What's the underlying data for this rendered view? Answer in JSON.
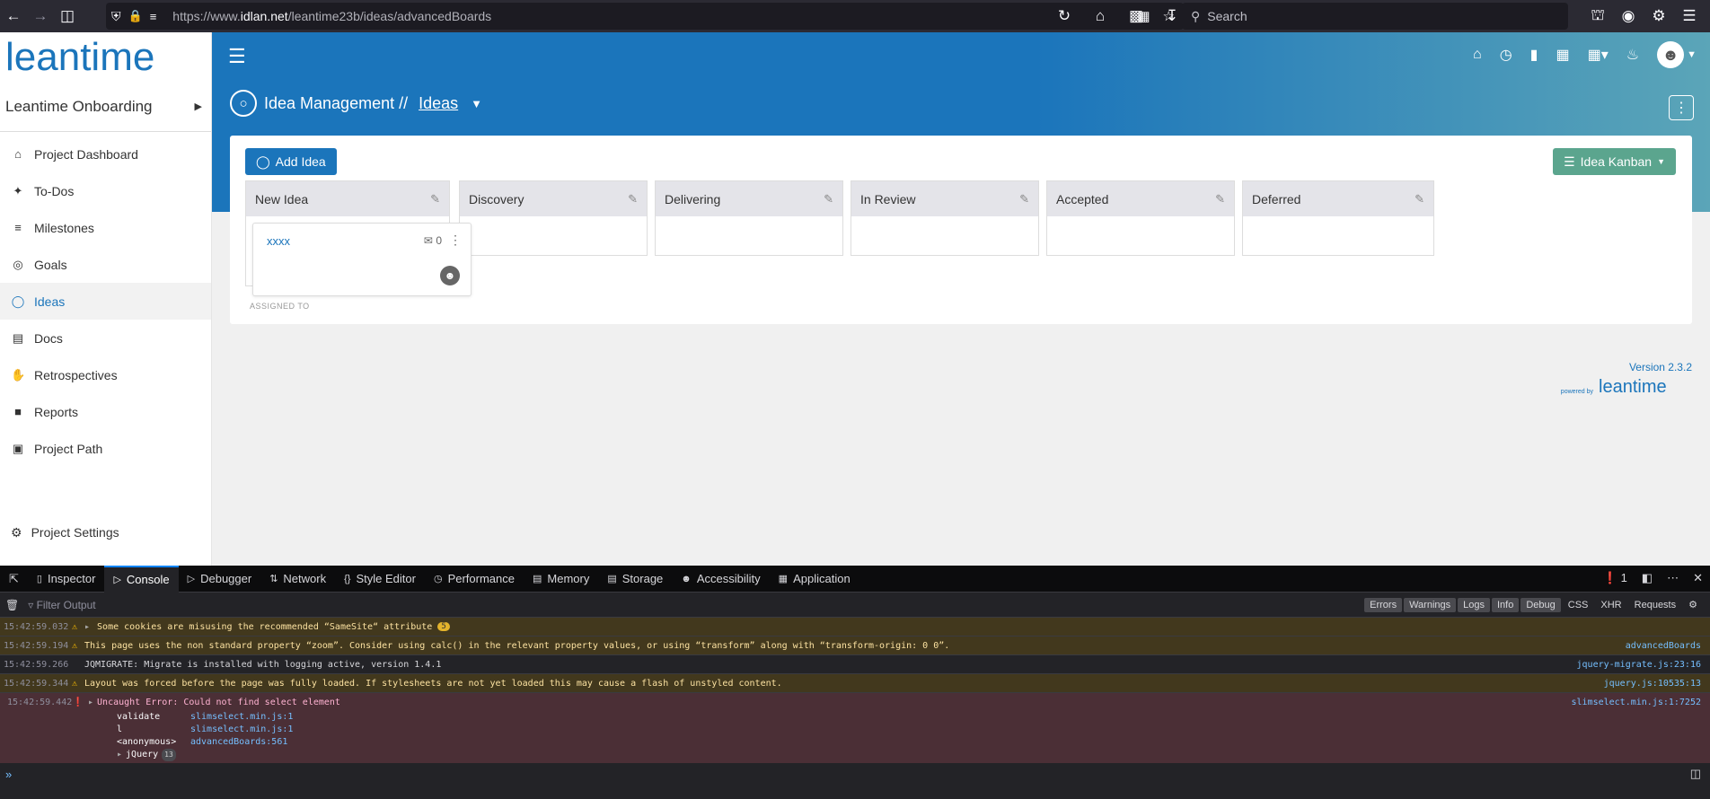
{
  "browser": {
    "url_prefix": "https://www.",
    "url_domain": "idlan.net",
    "url_path": "/leantime23b/ideas/advancedBoards",
    "search_placeholder": "Search"
  },
  "sidebar": {
    "logo_text": "leantime",
    "project_name": "Leantime Onboarding",
    "items": [
      {
        "label": "Project Dashboard",
        "icon": "home-icon"
      },
      {
        "label": "To-Dos",
        "icon": "pin-icon"
      },
      {
        "label": "Milestones",
        "icon": "sliders-icon"
      },
      {
        "label": "Goals",
        "icon": "target-icon"
      },
      {
        "label": "Ideas",
        "icon": "lightbulb-icon",
        "active": true
      },
      {
        "label": "Docs",
        "icon": "book-icon"
      },
      {
        "label": "Retrospectives",
        "icon": "hand-icon"
      },
      {
        "label": "Reports",
        "icon": "chart-icon"
      },
      {
        "label": "Project Path",
        "icon": "map-icon"
      }
    ],
    "settings_label": "Project Settings"
  },
  "header": {
    "title_prefix": "Idea Management //",
    "title_link": "Ideas"
  },
  "board": {
    "add_button": "Add Idea",
    "kanban_button": "Idea Kanban",
    "columns": [
      {
        "name": "New Idea"
      },
      {
        "name": "Discovery"
      },
      {
        "name": "Delivering"
      },
      {
        "name": "In Review"
      },
      {
        "name": "Accepted"
      },
      {
        "name": "Deferred"
      }
    ],
    "card": {
      "title": "xxxx",
      "comment_count": "0",
      "assigned_label": "ASSIGNED TO"
    }
  },
  "footer": {
    "version": "Version 2.3.2",
    "powered_by": "powered by",
    "powered_logo": "leantime"
  },
  "devtools": {
    "tabs": [
      "Inspector",
      "Console",
      "Debugger",
      "Network",
      "Style Editor",
      "Performance",
      "Memory",
      "Storage",
      "Accessibility",
      "Application"
    ],
    "error_count": "1",
    "filter_placeholder": "Filter Output",
    "filters": [
      "Errors",
      "Warnings",
      "Logs",
      "Info",
      "Debug"
    ],
    "filters_extra": [
      "CSS",
      "XHR",
      "Requests"
    ],
    "logs": [
      {
        "time": "15:42:59.032",
        "type": "warn",
        "text": "Some cookies are misusing the recommended “SameSite“ attribute",
        "badge": "5",
        "source": ""
      },
      {
        "time": "15:42:59.194",
        "type": "warn",
        "text": "This page uses the non standard property “zoom”. Consider using calc() in the relevant property values, or using “transform” along with “transform-origin: 0 0”.",
        "source": "advancedBoards"
      },
      {
        "time": "15:42:59.266",
        "type": "info",
        "text": "JQMIGRATE: Migrate is installed with logging active, version 1.4.1",
        "source": "jquery-migrate.js:23:16"
      },
      {
        "time": "15:42:59.344",
        "type": "warn",
        "text": "Layout was forced before the page was fully loaded. If stylesheets are not yet loaded this may cause a flash of unstyled content.",
        "source": "jquery.js:10535:13"
      }
    ],
    "error": {
      "time": "15:42:59.442",
      "text": "Uncaught Error: Could not find select element",
      "source": "slimselect.min.js:1:7252",
      "stack": [
        {
          "fn": "validate",
          "loc": "slimselect.min.js:1"
        },
        {
          "fn": "l",
          "loc": "slimselect.min.js:1"
        },
        {
          "fn": "<anonymous>",
          "loc": "advancedBoards:561"
        }
      ],
      "jquery_label": "jQuery",
      "jquery_count": "13"
    }
  }
}
